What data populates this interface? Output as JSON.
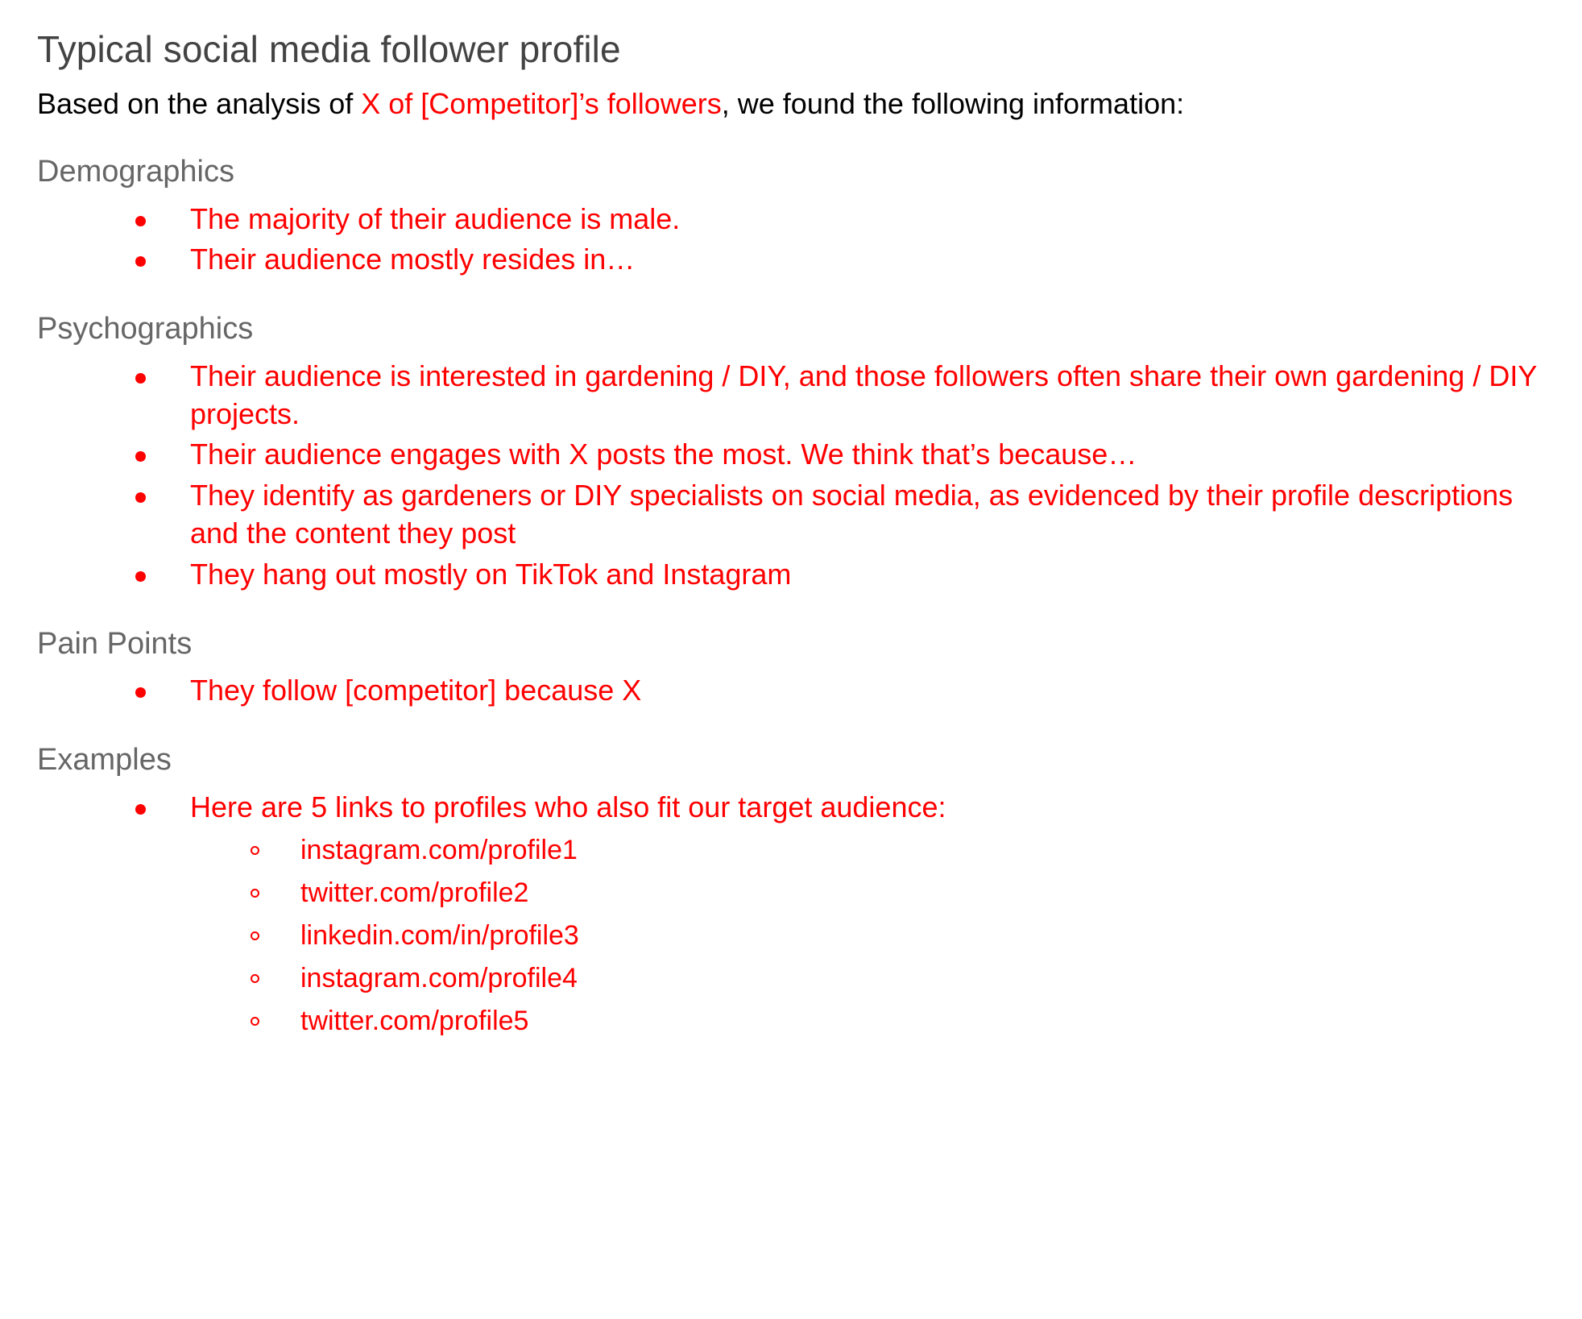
{
  "document": {
    "title": "Typical social media follower profile",
    "intro": {
      "before": "Based on the analysis of ",
      "highlight": "X of [Competitor]’s followers",
      "after": ", we found the following information:"
    },
    "colors": {
      "title": "#434343",
      "heading": "#666666",
      "body": "#000000",
      "highlight": "#ff0000",
      "background": "#ffffff"
    },
    "sections": [
      {
        "heading": "Demographics",
        "bullets": [
          {
            "text": "The majority of their audience is male."
          },
          {
            "text": "Their audience mostly resides in…"
          }
        ]
      },
      {
        "heading": "Psychographics",
        "bullets": [
          {
            "text": "Their audience is interested in gardening / DIY, and those followers often share their own gardening / DIY projects."
          },
          {
            "text": "Their audience engages with X posts the most. We think that’s because…"
          },
          {
            "text": "They identify as gardeners or DIY specialists on social media, as evidenced by their profile descriptions and the content they post"
          },
          {
            "text": "They hang out mostly on TikTok and Instagram"
          }
        ]
      },
      {
        "heading": "Pain Points",
        "bullets": [
          {
            "text": "They follow [competitor] because X"
          }
        ]
      },
      {
        "heading": "Examples",
        "bullets": [
          {
            "text": "Here are 5 links to profiles who also fit our target audience:",
            "sub": [
              "instagram.com/profile1",
              "twitter.com/profile2",
              "linkedin.com/in/profile3",
              "instagram.com/profile4",
              "twitter.com/profile5"
            ]
          }
        ]
      }
    ]
  }
}
